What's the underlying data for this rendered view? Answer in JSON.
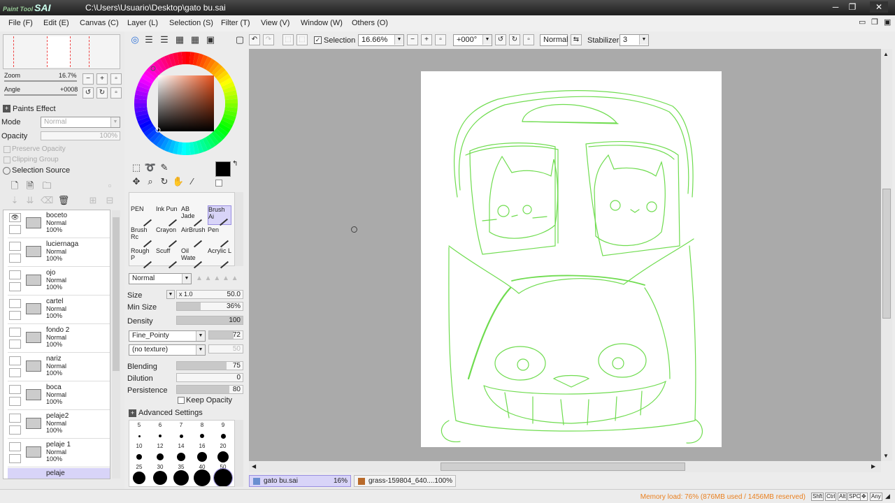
{
  "app": {
    "title": "C:\\Users\\Usuario\\Desktop\\gato bu.sai",
    "logo_small": "Paint Tool",
    "logo": "SAI"
  },
  "menu": [
    "File (F)",
    "Edit (E)",
    "Canvas (C)",
    "Layer (L)",
    "Selection (S)",
    "Filter (T)",
    "View (V)",
    "Window (W)",
    "Others (O)"
  ],
  "navigator": {
    "zoom_label": "Zoom",
    "zoom_value": "16.7%",
    "angle_label": "Angle",
    "angle_value": "+0008"
  },
  "paints_effect": {
    "header": "Paints Effect",
    "mode_label": "Mode",
    "mode_value": "Normal",
    "opacity_label": "Opacity",
    "opacity_value": "100%",
    "preserve_opacity": "Preserve Opacity",
    "clipping_group": "Clipping Group",
    "selection_source": "Selection Source"
  },
  "layers": [
    {
      "name": "boceto",
      "mode": "Normal",
      "opacity": "100%"
    },
    {
      "name": "luciernaga",
      "mode": "Normal",
      "opacity": "100%"
    },
    {
      "name": "ojo",
      "mode": "Normal",
      "opacity": "100%"
    },
    {
      "name": "cartel",
      "mode": "Normal",
      "opacity": "100%"
    },
    {
      "name": "fondo 2",
      "mode": "Normal",
      "opacity": "100%"
    },
    {
      "name": "nariz",
      "mode": "Normal",
      "opacity": "100%"
    },
    {
      "name": "boca",
      "mode": "Normal",
      "opacity": "100%"
    },
    {
      "name": "pelaje2",
      "mode": "Normal",
      "opacity": "100%"
    },
    {
      "name": "pelaje 1",
      "mode": "Normal",
      "opacity": "100%"
    },
    {
      "name": "pelaje",
      "mode": "",
      "opacity": ""
    }
  ],
  "brushes": [
    "PEN",
    "Ink Pun",
    "AB Jade",
    "Brush Ai",
    "Brush Rc",
    "Crayon",
    "AirBrush",
    "Pen",
    "Rough P",
    "Scuff",
    "Oil Wate",
    "Acrylic L"
  ],
  "brush_settings": {
    "blend_mode": "Normal",
    "size_label": "Size",
    "size_mult": "x 1.0",
    "size_value": "50.0",
    "min_size_label": "Min Size",
    "min_size_value": "36%",
    "min_size_fraction": 0.36,
    "density_label": "Density",
    "density_value": "100",
    "shape": "Fine_Pointy",
    "shape_value": "72",
    "texture": "(no texture)",
    "texture_value": "50",
    "blending_label": "Blending",
    "blending_value": "75",
    "blending_fraction": 0.75,
    "dilution_label": "Dilution",
    "dilution_value": "0",
    "persistence_label": "Persistence",
    "persistence_value": "80",
    "persistence_fraction": 0.8,
    "keep_opacity": "Keep Opacity",
    "advanced": "Advanced Settings"
  },
  "brush_sizes": [
    "5",
    "6",
    "7",
    "8",
    "9",
    "10",
    "12",
    "14",
    "16",
    "20",
    "25",
    "30",
    "35",
    "40",
    "50"
  ],
  "toolbar": {
    "selection_label": "Selection",
    "zoom": "16.66%",
    "angle": "+000°",
    "blend": "Normal",
    "stabilizer_label": "Stabilizer",
    "stabilizer_value": "3"
  },
  "tabs": [
    {
      "name": "gato bu.sai",
      "zoom": "16%"
    },
    {
      "name": "grass-159804_640....",
      "zoom": "100%"
    }
  ],
  "status": {
    "memory": "Memory load: 76% (876MB used / 1456MB reserved)",
    "keys": [
      "Shft",
      "Ctrl",
      "Alt",
      "SPC",
      "Any"
    ]
  },
  "colors": {
    "primary": "#000000",
    "secondary": "#dde8f8",
    "sketch": "#6fdc4f",
    "accent": "#e98020"
  }
}
